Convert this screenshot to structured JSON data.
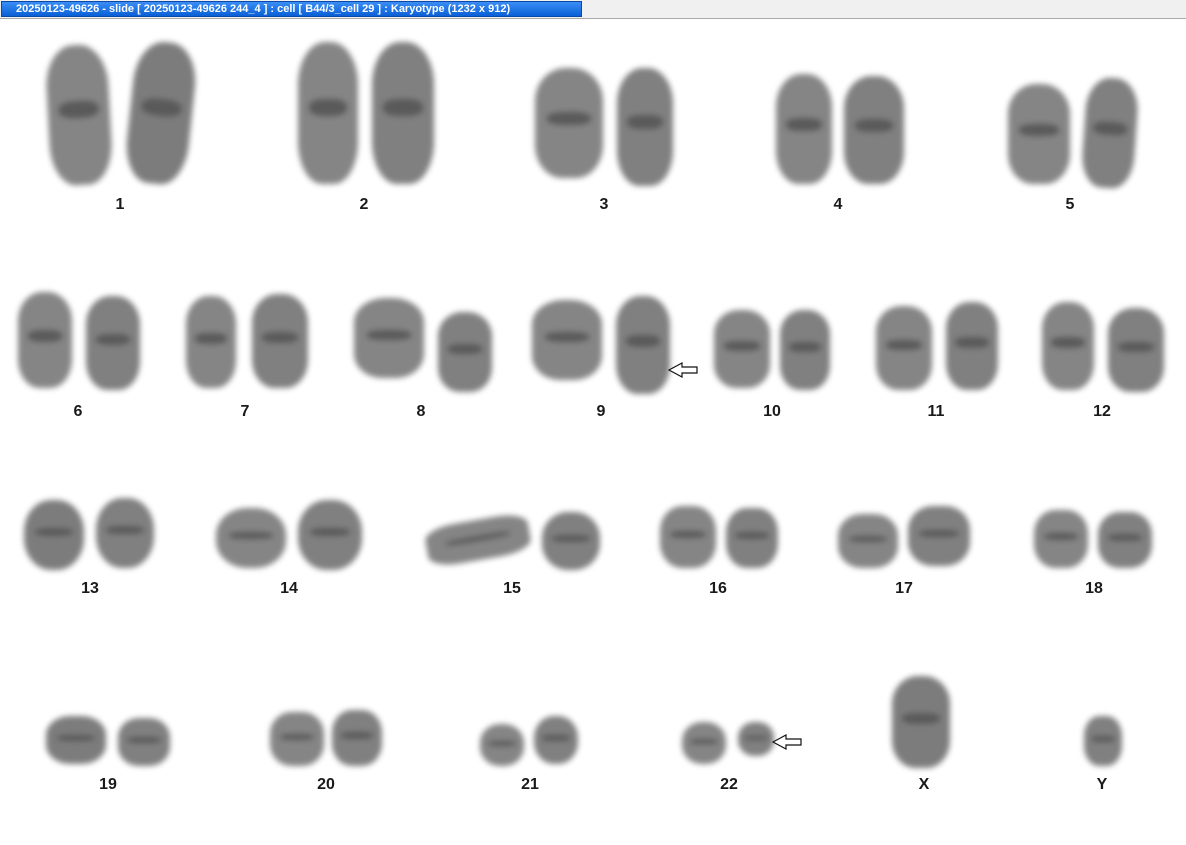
{
  "window": {
    "title": "20250123-49626 - slide [ 20250123-49626 244_4 ] : cell [ B44/3_cell 29 ] : Karyotype  (1232 x 912)"
  },
  "karyotype": {
    "labels": {
      "c1": "1",
      "c2": "2",
      "c3": "3",
      "c4": "4",
      "c5": "5",
      "c6": "6",
      "c7": "7",
      "c8": "8",
      "c9": "9",
      "c10": "10",
      "c11": "11",
      "c12": "12",
      "c13": "13",
      "c14": "14",
      "c15": "15",
      "c16": "16",
      "c17": "17",
      "c18": "18",
      "c19": "19",
      "c20": "20",
      "c21": "21",
      "c22": "22",
      "cX": "X",
      "cY": "Y"
    },
    "chromosome_color": "#6a6a6a",
    "arrows": [
      "chromosome 9",
      "chromosome 22"
    ]
  }
}
